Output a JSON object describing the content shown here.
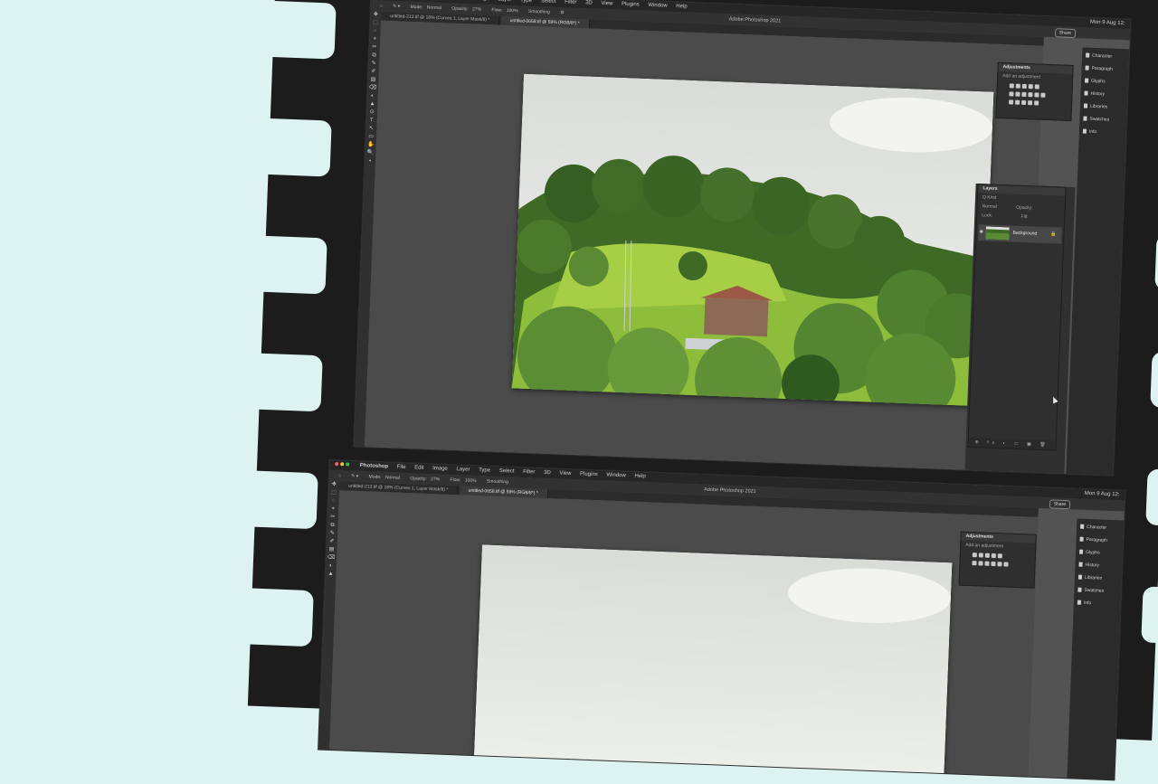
{
  "app": {
    "name": "Photoshop",
    "title": "Adobe Photoshop 2021",
    "clock": "Mon 9 Aug  12:",
    "share_label": "Share"
  },
  "menu": [
    "Photoshop",
    "File",
    "Edit",
    "Image",
    "Layer",
    "Type",
    "Select",
    "Filter",
    "3D",
    "View",
    "Plugins",
    "Window",
    "Help"
  ],
  "options_bar": {
    "mode_label": "Mode:",
    "mode_value": "Normal",
    "opacity_label": "Opacity:",
    "opacity_value": "27%",
    "flow_label": "Flow:",
    "flow_value": "100%",
    "smoothing_label": "Smoothing"
  },
  "tabs": [
    "untitled-213.tif @ 18% (Curves 1, Layer Mask/8) *",
    "untitled-0658.tif @ 59% (RGB/8*) *"
  ],
  "tools": [
    "✥",
    "⬚",
    "◌",
    "⌖",
    "✂",
    "⧉",
    "✎",
    "✐",
    "▤",
    "⌫",
    "◐",
    "▲",
    "⊙",
    "T",
    "↖",
    "▭",
    "✋",
    "🔍",
    "▪"
  ],
  "adjustments_panel": {
    "title": "Adjustments",
    "subtitle": "Add an adjustment"
  },
  "layers_panel": {
    "title": "Layers",
    "kind_label": "Q Kind",
    "blend_mode": "Normal",
    "opacity_label": "Opacity:",
    "lock_label": "Lock:",
    "fill_label": "Fill:",
    "layer_name": "Background",
    "footer_icons": "⊕ fx ◐ ▭ ▣ 🗑"
  },
  "dock": [
    "Character",
    "Paragraph",
    "Glyphs",
    "History",
    "Libraries",
    "Swatches",
    "Info"
  ],
  "colors": {
    "background": "#dcf3ef",
    "film": "#1c1c1c",
    "workspace": "#535353",
    "panel": "#2f2f2f"
  }
}
